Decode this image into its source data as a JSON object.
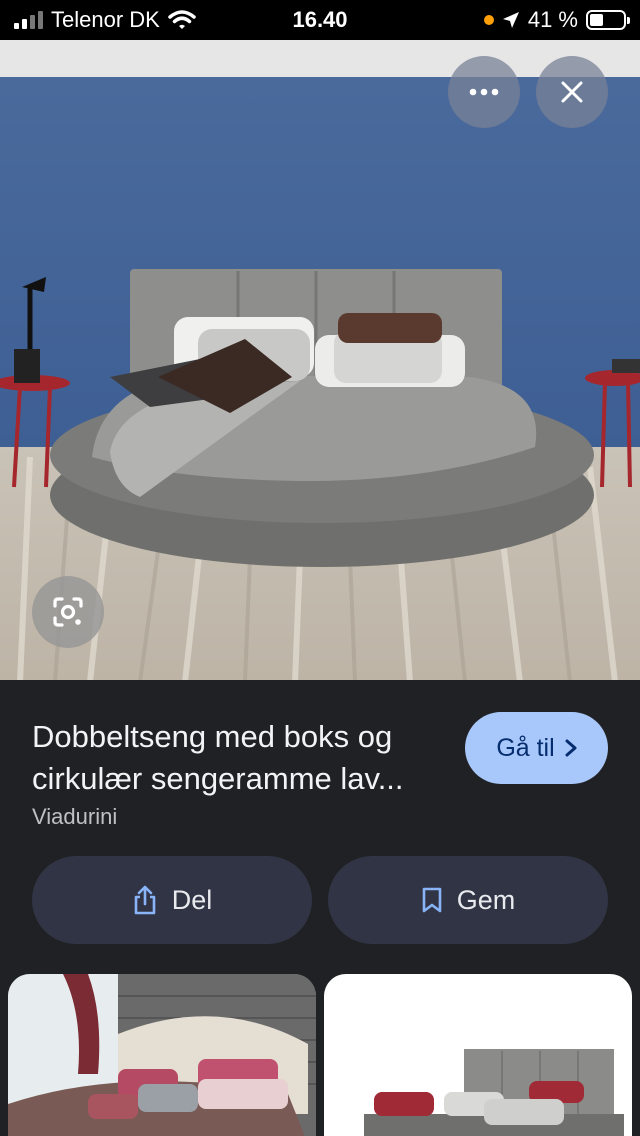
{
  "status_bar": {
    "carrier": "Telenor DK",
    "time": "16.40",
    "battery_percent": "41 %",
    "battery_level": 0.41
  },
  "viewer": {
    "more_icon": "more-horizontal-icon",
    "close_icon": "close-icon",
    "lens_icon": "google-lens-icon"
  },
  "result": {
    "title": "Dobbeltseng med boks og cirkulær sengeramme lav...",
    "source": "Viadurini",
    "goto_label": "Gå til",
    "share_label": "Del",
    "save_label": "Gem"
  },
  "colors": {
    "accent": "#a8c7fa",
    "pill_bg": "#303445",
    "panel_bg": "#202124"
  }
}
